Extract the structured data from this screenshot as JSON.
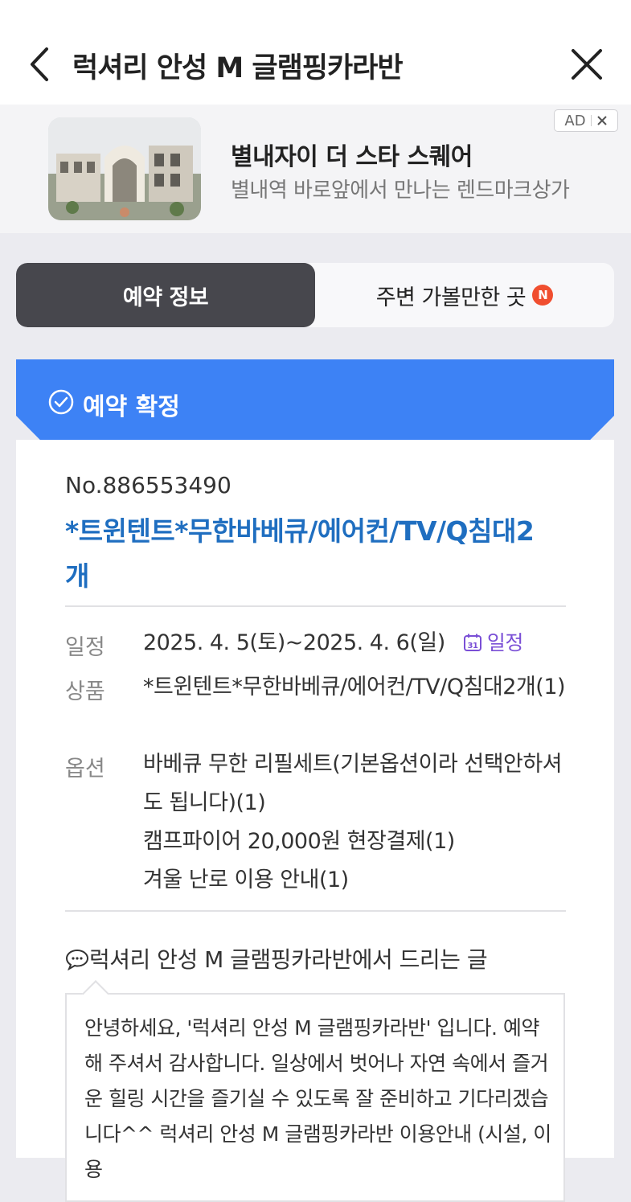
{
  "header": {
    "title": "럭셔리 안성 M 글램핑카라반"
  },
  "ad": {
    "title": "별내자이 더 스타 스퀘어",
    "description": "별내역 바로앞에서 만나는 렌드마크상가",
    "badge": "AD"
  },
  "tabs": [
    {
      "label": "예약 정보",
      "active": true
    },
    {
      "label": "주변 가볼만한 곳",
      "active": false,
      "badge": "N"
    }
  ],
  "status": {
    "label": "예약 확정"
  },
  "reservation": {
    "number": "No.886553490",
    "product_title": "*트윈텐트*무한바베큐/에어컨/TV/Q침대2개",
    "schedule_label": "일정",
    "schedule_value": "2025. 4. 5(토)~2025. 4. 6(일)",
    "calendar_link": "일정",
    "product_label": "상품",
    "product_value": "*트윈텐트*무한바베큐/에어컨/TV/Q침대2개(1)",
    "options_label": "옵션",
    "options": [
      "바베큐 무한 리필세트(기본옵션이라 선택안하셔도 됩니다)(1)",
      "캠프파이어 20,000원 현장결제(1)",
      "겨울 난로 이용 안내(1)"
    ]
  },
  "message": {
    "title": "럭셔리 안성 M 글램핑카라반에서 드리는 글",
    "body": "안녕하세요, '럭셔리 안성 M 글램핑카라반' 입니다. 예약해 주셔서 감사합니다. 일상에서 벗어나 자연 속에서 즐거운 힐링 시간을 즐기실 수 있도록 잘 준비하고 기다리겠습니다^^ 럭셔리 안성 M 글램핑카라반 이용안내 (시설, 이용"
  },
  "colors": {
    "accent_blue": "#3d82f5",
    "title_blue": "#1f6ec0",
    "tab_active": "#47474d",
    "calendar_purple": "#7a4fd6",
    "new_badge": "#f04e2f"
  }
}
